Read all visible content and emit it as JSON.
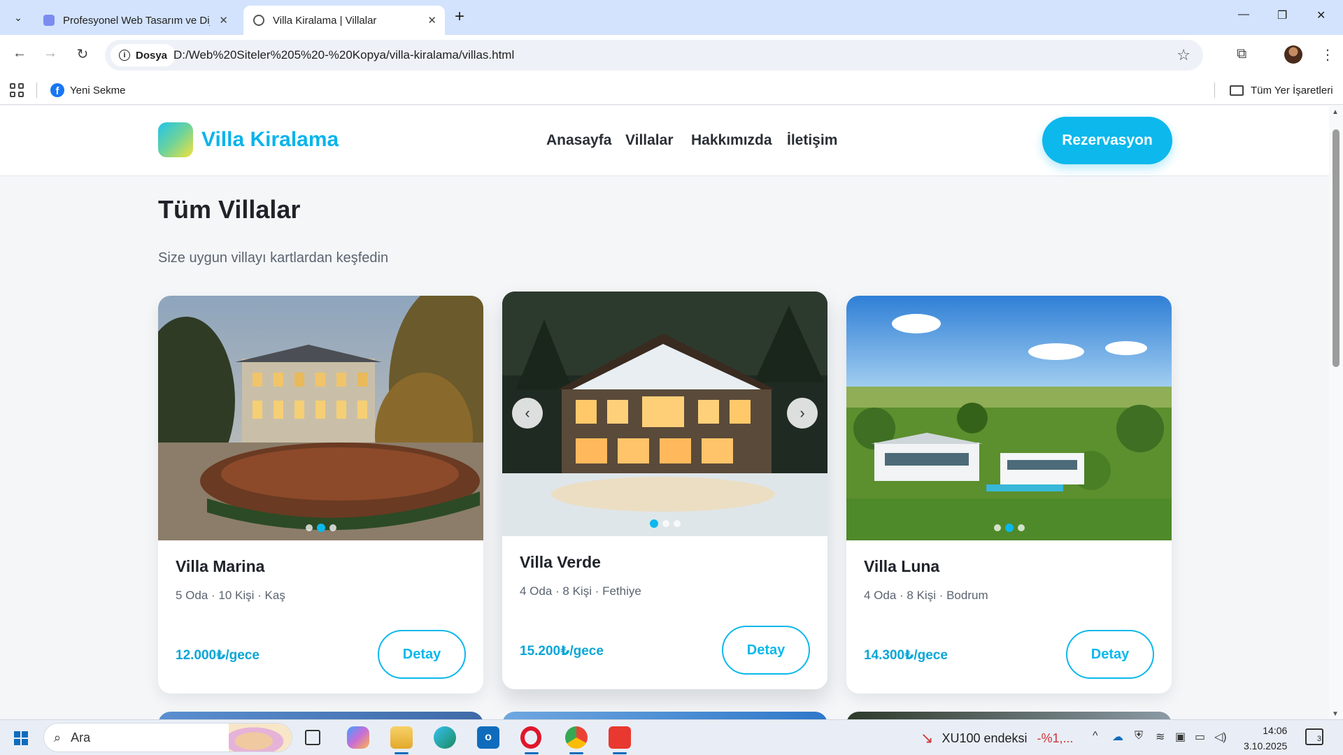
{
  "browser": {
    "tabs": [
      {
        "title": "Profesyonel Web Tasarım ve Dij",
        "active": false
      },
      {
        "title": "Villa Kiralama | Villalar",
        "active": true
      }
    ],
    "site_chip": "Dosya",
    "url": "D:/Web%20Siteler%205%20-%20Kopya/villa-kiralama/villas.html",
    "bookmarks": {
      "left_item": "Yeni Sekme",
      "right_item": "Tüm Yer İşaretleri"
    }
  },
  "site": {
    "brand": "Villa Kiralama",
    "nav": [
      "Anasayfa",
      "Villalar",
      "Hakkımızda",
      "İletişim"
    ],
    "cta": "Rezervasyon",
    "accent_color": "#0cb8ec"
  },
  "page": {
    "title": "Tüm Villalar",
    "subtitle": "Size uygun villayı kartlardan keşfedin"
  },
  "villas": [
    {
      "name": "Villa Marina",
      "meta": "5 Oda · 10 Kişi · Kaş",
      "price": "12.000₺/gece",
      "button": "Detay",
      "active_slide": 2,
      "slides": 3
    },
    {
      "name": "Villa Verde",
      "meta": "4 Oda · 8 Kişi · Fethiye",
      "price": "15.200₺/gece",
      "button": "Detay",
      "active_slide": 1,
      "slides": 3,
      "prev_arrow": "‹",
      "next_arrow": "›"
    },
    {
      "name": "Villa Luna",
      "meta": "4 Oda · 8 Kişi · Bodrum",
      "price": "14.300₺/gece",
      "button": "Detay",
      "active_slide": 2,
      "slides": 3
    }
  ],
  "taskbar": {
    "search_placeholder": "Ara",
    "ticker_label": "XU100 endeksi",
    "ticker_value": "-%1,...",
    "time": "14:06",
    "date": "3.10.2025",
    "notifications": "3"
  }
}
